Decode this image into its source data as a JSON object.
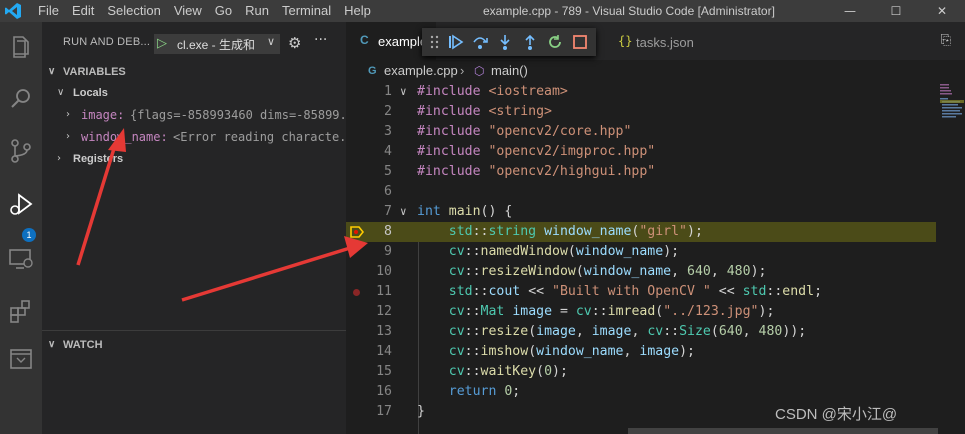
{
  "titlebar": {
    "menu": [
      "File",
      "Edit",
      "Selection",
      "View",
      "Go",
      "Run",
      "Terminal",
      "Help"
    ],
    "title": "example.cpp - 789 - Visual Studio Code [Administrator]",
    "controls": [
      "—",
      "☐",
      "✕"
    ]
  },
  "activity": {
    "icons": [
      "explorer-icon",
      "search-icon",
      "source-control-icon",
      "run-debug-icon",
      "remote-explorer-icon",
      "extensions-icon",
      "testing-icon"
    ],
    "debug_badge": "1"
  },
  "sidebar": {
    "title": "RUN AND DEB...",
    "config": "cl.exe - 生成和",
    "variables": {
      "title": "VARIABLES",
      "locals_label": "Locals",
      "items": [
        {
          "name": "image:",
          "value": "{flags=-858993460 dims=-85899..."
        },
        {
          "name": "window_name:",
          "value": "<Error reading characte..."
        }
      ],
      "registers_label": "Registers"
    },
    "watch_title": "WATCH"
  },
  "editor": {
    "tabs": [
      {
        "label": "example",
        "icon": "C"
      },
      {
        "label": "tasks.json",
        "icon": "{}"
      }
    ],
    "debug_toolbar": [
      "drag-handle-icon",
      "continue-icon",
      "step-over-icon",
      "step-into-icon",
      "step-out-icon",
      "restart-icon",
      "stop-icon"
    ],
    "breadcrumb": {
      "file": "example.cpp",
      "symbol": "main()"
    },
    "current_line": 8,
    "breakpoint_line": 11,
    "lines": [
      {
        "n": "1",
        "fold": "∨",
        "tokens": [
          [
            "pp",
            "#include "
          ],
          [
            "str",
            "<iostream>"
          ]
        ]
      },
      {
        "n": "2",
        "fold": "",
        "tokens": [
          [
            "pp",
            "#include "
          ],
          [
            "str",
            "<string>"
          ]
        ]
      },
      {
        "n": "3",
        "fold": "",
        "tokens": [
          [
            "pp",
            "#include "
          ],
          [
            "str",
            "\"opencv2/core.hpp\""
          ]
        ]
      },
      {
        "n": "4",
        "fold": "",
        "tokens": [
          [
            "pp",
            "#include "
          ],
          [
            "str",
            "\"opencv2/imgproc.hpp\""
          ]
        ]
      },
      {
        "n": "5",
        "fold": "",
        "tokens": [
          [
            "pp",
            "#include "
          ],
          [
            "str",
            "\"opencv2/highgui.hpp\""
          ]
        ]
      },
      {
        "n": "6",
        "fold": "",
        "tokens": []
      },
      {
        "n": "7",
        "fold": "∨",
        "tokens": [
          [
            "kw",
            "int "
          ],
          [
            "fn",
            "main"
          ],
          [
            "plain",
            "() {"
          ]
        ]
      },
      {
        "n": "8",
        "fold": "",
        "tokens": [
          [
            "plain",
            "    "
          ],
          [
            "ns",
            "std"
          ],
          [
            "plain",
            "::"
          ],
          [
            "ns",
            "string "
          ],
          [
            "var",
            "window_name"
          ],
          [
            "plain",
            "("
          ],
          [
            "str",
            "\"girl\""
          ],
          [
            "plain",
            ");"
          ]
        ]
      },
      {
        "n": "9",
        "fold": "",
        "tokens": [
          [
            "plain",
            "    "
          ],
          [
            "ns",
            "cv"
          ],
          [
            "plain",
            "::"
          ],
          [
            "fn",
            "namedWindow"
          ],
          [
            "plain",
            "("
          ],
          [
            "var",
            "window_name"
          ],
          [
            "plain",
            ");"
          ]
        ]
      },
      {
        "n": "10",
        "fold": "",
        "tokens": [
          [
            "plain",
            "    "
          ],
          [
            "ns",
            "cv"
          ],
          [
            "plain",
            "::"
          ],
          [
            "fn",
            "resizeWindow"
          ],
          [
            "plain",
            "("
          ],
          [
            "var",
            "window_name"
          ],
          [
            "plain",
            ", "
          ],
          [
            "num",
            "640"
          ],
          [
            "plain",
            ", "
          ],
          [
            "num",
            "480"
          ],
          [
            "plain",
            ");"
          ]
        ]
      },
      {
        "n": "11",
        "fold": "",
        "tokens": [
          [
            "plain",
            "    "
          ],
          [
            "ns",
            "std"
          ],
          [
            "plain",
            "::"
          ],
          [
            "var",
            "cout"
          ],
          [
            "plain",
            " << "
          ],
          [
            "str",
            "\"Built with OpenCV \""
          ],
          [
            "plain",
            " << "
          ],
          [
            "ns",
            "std"
          ],
          [
            "plain",
            "::"
          ],
          [
            "fn",
            "endl"
          ],
          [
            "plain",
            ";"
          ]
        ]
      },
      {
        "n": "12",
        "fold": "",
        "tokens": [
          [
            "plain",
            "    "
          ],
          [
            "ns",
            "cv"
          ],
          [
            "plain",
            "::"
          ],
          [
            "ns",
            "Mat "
          ],
          [
            "var",
            "image"
          ],
          [
            "plain",
            " = "
          ],
          [
            "ns",
            "cv"
          ],
          [
            "plain",
            "::"
          ],
          [
            "fn",
            "imread"
          ],
          [
            "plain",
            "("
          ],
          [
            "str",
            "\"../123.jpg\""
          ],
          [
            "plain",
            ");"
          ]
        ]
      },
      {
        "n": "13",
        "fold": "",
        "tokens": [
          [
            "plain",
            "    "
          ],
          [
            "ns",
            "cv"
          ],
          [
            "plain",
            "::"
          ],
          [
            "fn",
            "resize"
          ],
          [
            "plain",
            "("
          ],
          [
            "var",
            "image"
          ],
          [
            "plain",
            ", "
          ],
          [
            "var",
            "image"
          ],
          [
            "plain",
            ", "
          ],
          [
            "ns",
            "cv"
          ],
          [
            "plain",
            "::"
          ],
          [
            "ns",
            "Size"
          ],
          [
            "plain",
            "("
          ],
          [
            "num",
            "640"
          ],
          [
            "plain",
            ", "
          ],
          [
            "num",
            "480"
          ],
          [
            "plain",
            "));"
          ]
        ]
      },
      {
        "n": "14",
        "fold": "",
        "tokens": [
          [
            "plain",
            "    "
          ],
          [
            "ns",
            "cv"
          ],
          [
            "plain",
            "::"
          ],
          [
            "fn",
            "imshow"
          ],
          [
            "plain",
            "("
          ],
          [
            "var",
            "window_name"
          ],
          [
            "plain",
            ", "
          ],
          [
            "var",
            "image"
          ],
          [
            "plain",
            ");"
          ]
        ]
      },
      {
        "n": "15",
        "fold": "",
        "tokens": [
          [
            "plain",
            "    "
          ],
          [
            "ns",
            "cv"
          ],
          [
            "plain",
            "::"
          ],
          [
            "fn",
            "waitKey"
          ],
          [
            "plain",
            "("
          ],
          [
            "num",
            "0"
          ],
          [
            "plain",
            ");"
          ]
        ]
      },
      {
        "n": "16",
        "fold": "",
        "tokens": [
          [
            "plain",
            "    "
          ],
          [
            "kw",
            "return "
          ],
          [
            "num",
            "0"
          ],
          [
            "plain",
            ";"
          ]
        ]
      },
      {
        "n": "17",
        "fold": "",
        "tokens": [
          [
            "plain",
            "}"
          ]
        ]
      }
    ]
  },
  "watermark": "CSDN @宋小江@",
  "colors": {
    "accent": "#0e70c0",
    "annotation_arrow": "#e53935",
    "current_line_bg": "#4b4b18"
  }
}
